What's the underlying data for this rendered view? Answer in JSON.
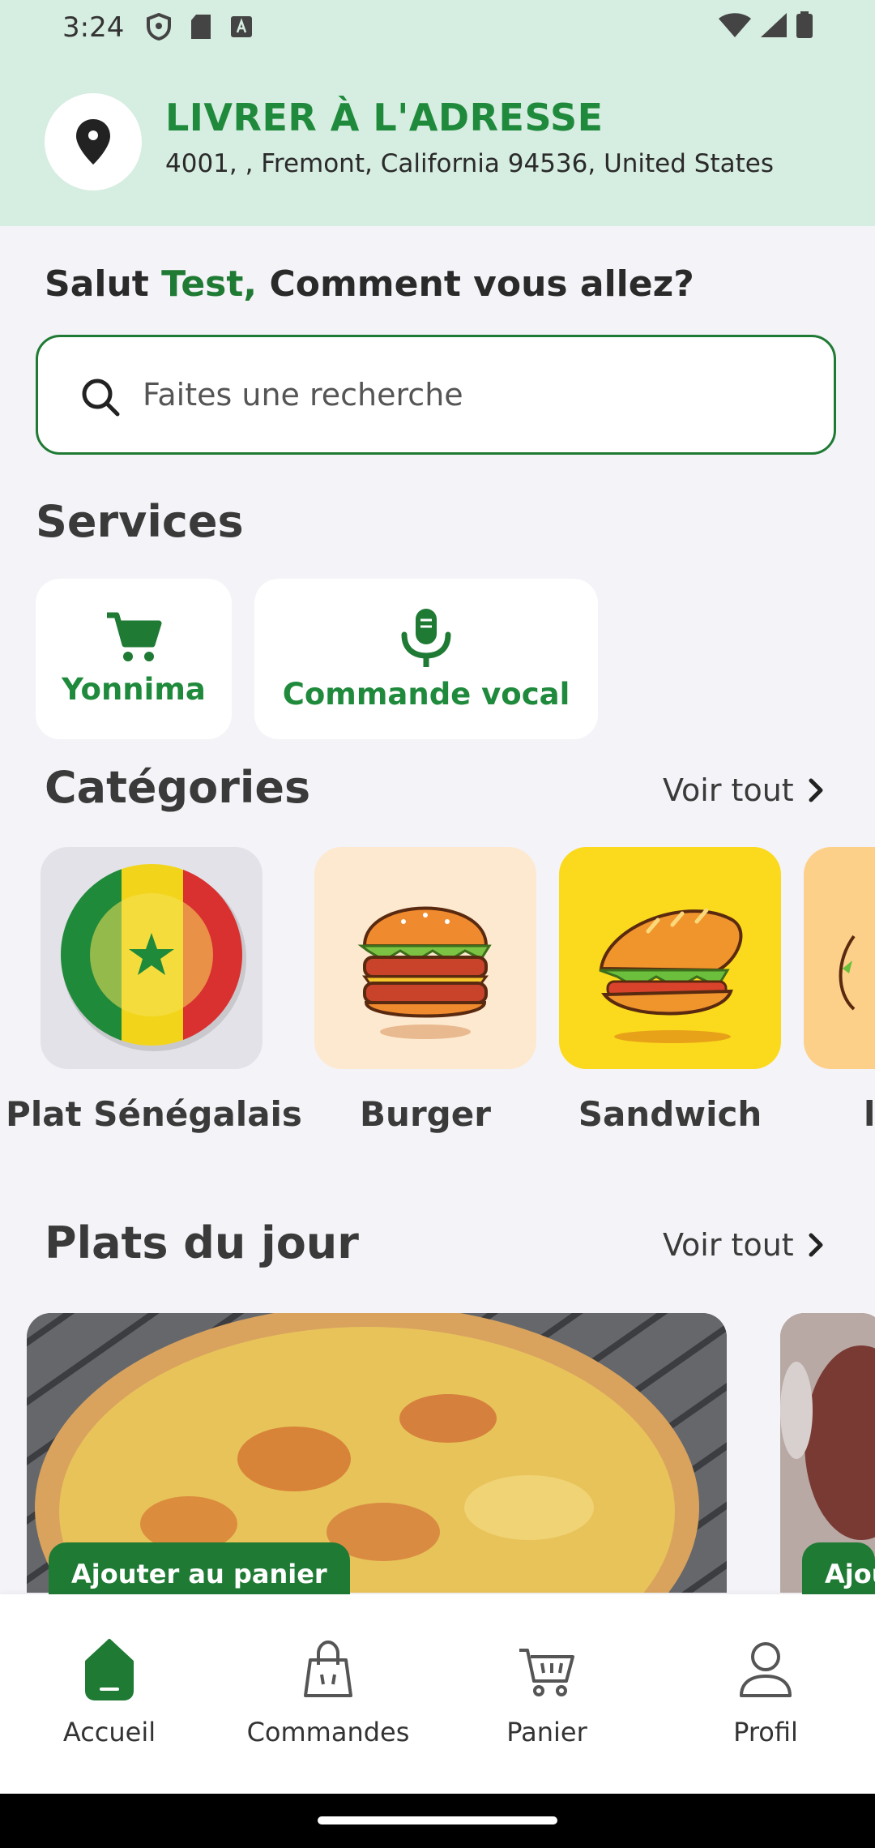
{
  "status_bar": {
    "time": "3:24"
  },
  "header": {
    "title": "LIVRER À L'ADRESSE",
    "address": "4001, , Fremont, California 94536, United States"
  },
  "greeting": {
    "hello": "Salut",
    "name": "Test,",
    "question": "Comment vous allez?"
  },
  "search": {
    "placeholder": "Faites une recherche"
  },
  "services": {
    "title": "Services",
    "items": [
      {
        "label": "Yonnima",
        "icon": "cart-icon"
      },
      {
        "label": "Commande vocal",
        "icon": "microphone-icon"
      }
    ]
  },
  "categories": {
    "title": "Catégories",
    "see_all": "Voir tout",
    "items": [
      {
        "label": "Plat Sénégalais"
      },
      {
        "label": "Burger"
      },
      {
        "label": "Sandwich"
      },
      {
        "label": ""
      }
    ]
  },
  "plats": {
    "title": "Plats du jour",
    "see_all": "Voir tout",
    "add_label": "Ajouter au panier",
    "add_label_partial": "Ajou"
  },
  "nav": {
    "items": [
      {
        "label": "Accueil",
        "icon": "home-icon"
      },
      {
        "label": "Commandes",
        "icon": "bag-icon"
      },
      {
        "label": "Panier",
        "icon": "cart-icon"
      },
      {
        "label": "Profil",
        "icon": "user-icon"
      }
    ]
  },
  "colors": {
    "primary": "#1f7a34",
    "accent": "#1f8a3c",
    "header_bg": "#d6ede1"
  }
}
